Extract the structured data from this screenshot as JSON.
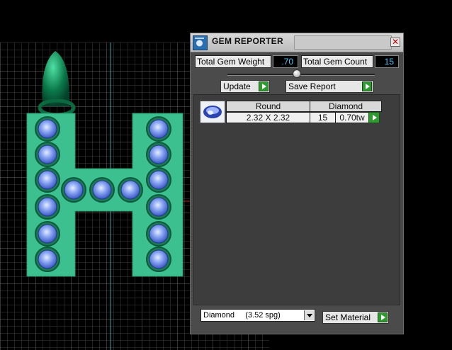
{
  "panel": {
    "title": "GEM REPORTER",
    "close_glyph": "✕",
    "total_weight_label": "Total Gem Weight",
    "total_weight_value": ".70",
    "total_count_label": "Total Gem Count",
    "total_count_value": "15",
    "update_label": "Update",
    "save_report_label": "Save Report",
    "table": {
      "shape_header": "Round",
      "material_header": "Diamond",
      "size": "2.32 X 2.32",
      "count": "15",
      "weight": "0.70tw"
    },
    "material_select": "Diamond     (3.52 spg)",
    "set_material_label": "Set Material"
  },
  "colors": {
    "pendant": "#3cc08f",
    "bail": "#0b7a4a",
    "gem": "#6a88e8",
    "grid": "#5a5a5a",
    "accent_arrow": "#2f9a2f",
    "value_text": "#48c8ff"
  },
  "icons": [
    "gem-reporter-logo-icon",
    "close-icon",
    "play-arrow-icon",
    "dropdown-arrow-icon",
    "round-gem-icon"
  ]
}
